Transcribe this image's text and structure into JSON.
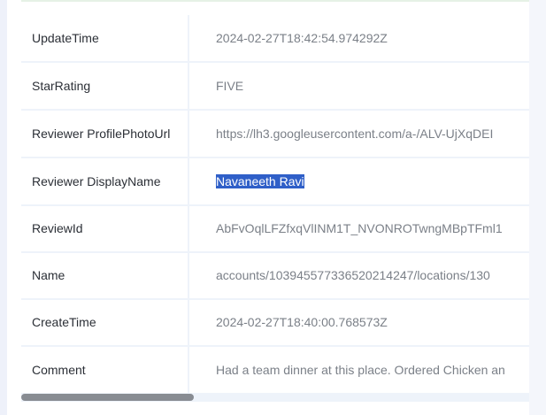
{
  "rows": [
    {
      "label": "UpdateTime",
      "value": "2024-02-27T18:42:54.974292Z"
    },
    {
      "label": "StarRating",
      "value": "FIVE"
    },
    {
      "label": "Reviewer ProfilePhotoUrl",
      "value": "https://lh3.googleusercontent.com/a-/ALV-UjXqDEI"
    },
    {
      "label": "Reviewer DisplayName",
      "value": "Navaneeth Ravi"
    },
    {
      "label": "ReviewId",
      "value": "AbFvOqlLFZfxqVlINM1T_NVONROTwngMBpTFml1"
    },
    {
      "label": "Name",
      "value": "accounts/103945577336520214247/locations/130"
    },
    {
      "label": "CreateTime",
      "value": "2024-02-27T18:40:00.768573Z"
    },
    {
      "label": "Comment",
      "value": "Had a team dinner at this place. Ordered Chicken an"
    }
  ],
  "selected_row_index": 3,
  "colors": {
    "selection": "#2f5fc8",
    "label_text": "#2b2f36",
    "value_text": "#7b8088",
    "grid_line": "#eef3fa",
    "scroll_thumb": "#888c92"
  }
}
